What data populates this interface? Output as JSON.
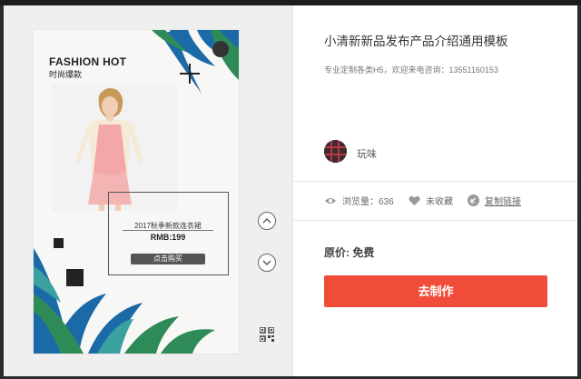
{
  "poster": {
    "title": "FASHION HOT",
    "subtitle": "时尚爆款",
    "product_name": "2017秋季新款连衣裙",
    "product_price": "RMB:199",
    "buy_button": "点击购买"
  },
  "template": {
    "title": "小清新新品发布产品介绍通用模板",
    "description": "专业定制各类H5，欢迎来电咨询：13551160153"
  },
  "author": {
    "name": "玩味"
  },
  "stats": {
    "views": "浏览量：636",
    "favorite": "未收藏",
    "copy_link": "复制链接"
  },
  "pricing": {
    "original_price": "原价: 免费"
  },
  "actions": {
    "make_button": "去制作"
  },
  "icons": {
    "nav_up": "chevron-up-icon",
    "nav_down": "chevron-down-icon",
    "qr": "qr-code-icon",
    "views": "eye-icon",
    "favorite": "heart-icon",
    "copy_link": "link-icon"
  },
  "colors": {
    "accent": "#f04c39",
    "leaf_blue": "#1b6aa8",
    "leaf_green": "#2e8b57"
  }
}
